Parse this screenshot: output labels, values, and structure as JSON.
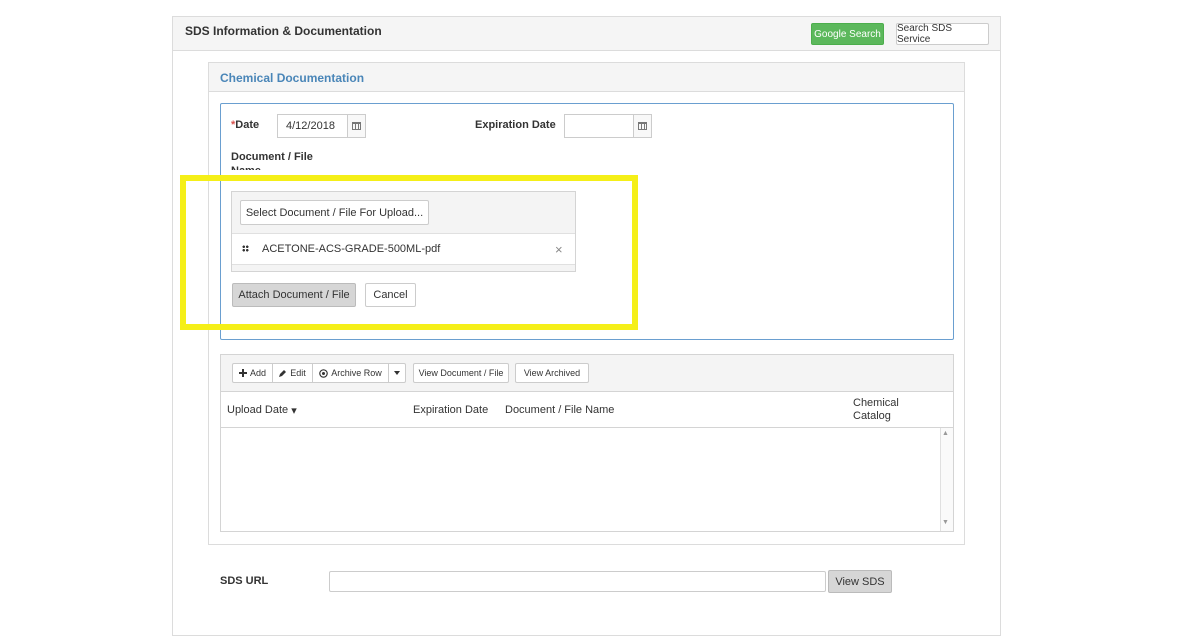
{
  "panel": {
    "title": "SDS Information & Documentation",
    "google_button": "Google Search",
    "search_service_button": "Search SDS Service"
  },
  "chem_doc": {
    "title": "Chemical Documentation",
    "required_marker": "*",
    "date_label": "Date",
    "date_value": "4/12/2018",
    "expiration_label": "Expiration Date",
    "expiration_value": "",
    "doc_name_label": "Document / File Name",
    "select_button": "Select Document / File For Upload...",
    "file_name": "ACETONE-ACS-GRADE-500ML-pdf",
    "remove_glyph": "×",
    "attach_button": "Attach Document / File",
    "cancel_button": "Cancel"
  },
  "grid": {
    "toolbar": {
      "add": "Add",
      "edit": "Edit",
      "archive": "Archive Row",
      "view_doc": "View Document / File",
      "view_archived": "View Archived"
    },
    "columns": {
      "upload_date": "Upload Date",
      "sort_glyph": "▾",
      "expiration_date": "Expiration Date",
      "document_name": "Document / File Name",
      "chemical_catalog": "Chemical Catalog"
    },
    "rows": []
  },
  "sds": {
    "label": "SDS URL",
    "url_value": "",
    "view_button": "View SDS"
  },
  "colors": {
    "accent_blue": "#4a86b8",
    "success_green": "#5cb85c",
    "highlight_yellow": "#f5ef18",
    "required_red": "#d9534f"
  }
}
